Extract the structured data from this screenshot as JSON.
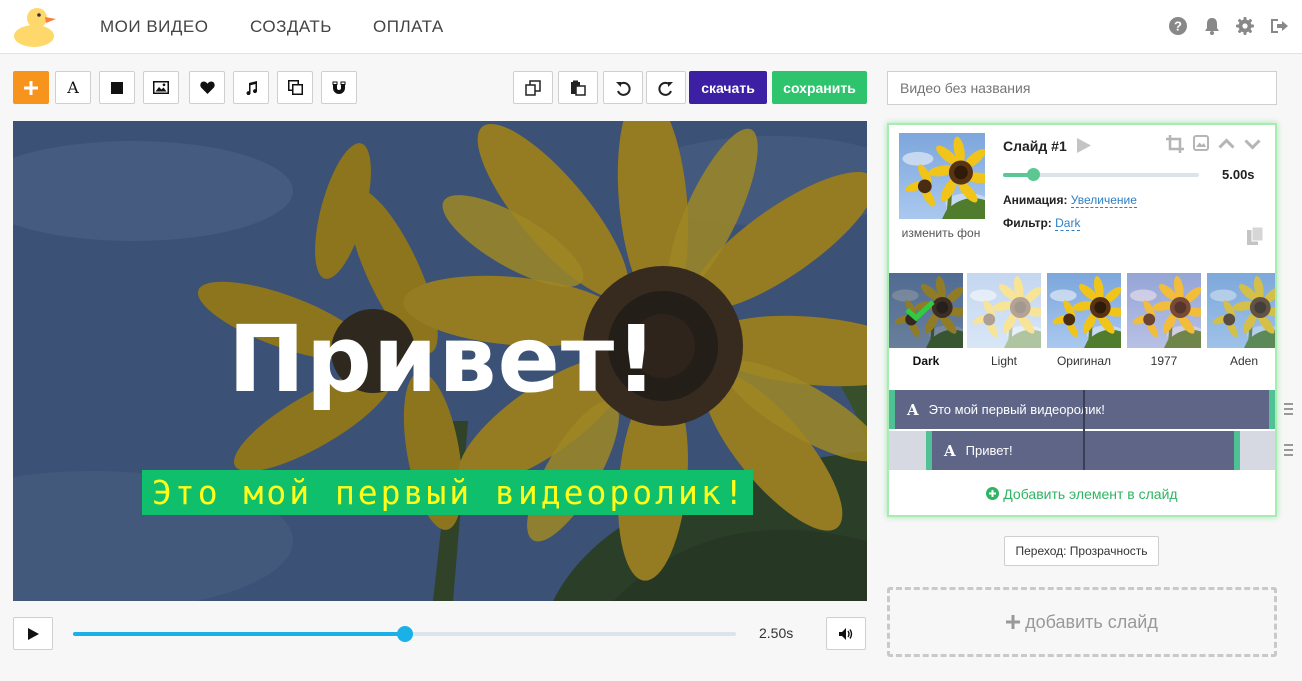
{
  "nav": {
    "items": [
      "МОИ ВИДЕО",
      "СОЗДАТЬ",
      "ОПЛАТА"
    ],
    "icons": [
      "help-icon",
      "bell-icon",
      "gear-icon",
      "logout-icon"
    ]
  },
  "toolbar": {
    "left_tools": [
      "add-icon",
      "text-icon",
      "square-icon",
      "image-icon",
      "heart-icon",
      "music-icon",
      "duplicate-icon",
      "magnet-icon"
    ],
    "right_tools": [
      "copy-icon",
      "paste-icon",
      "undo-icon",
      "redo-icon"
    ],
    "download_label": "скачать",
    "save_label": "сохранить",
    "download_color": "#3d1fa3",
    "save_color": "#2ec46d"
  },
  "canvas": {
    "title": "Привет!",
    "subtitle": "Это мой первый видеоролик!"
  },
  "player": {
    "time": "2.50s",
    "progress": 0.5
  },
  "project": {
    "name_placeholder": "Видео без названия"
  },
  "slide": {
    "title": "Слайд #1",
    "duration": "5.00s",
    "change_bg": "изменить фон",
    "animation_label": "Анимация:",
    "animation_value": "Увеличение",
    "filter_label": "Фильтр:",
    "filter_value": "Dark",
    "filters": [
      {
        "name": "Dark",
        "selected": true
      },
      {
        "name": "Light",
        "selected": false
      },
      {
        "name": "Оригинал",
        "selected": false
      },
      {
        "name": "1977",
        "selected": false
      },
      {
        "name": "Aden",
        "selected": false
      }
    ],
    "layers": [
      {
        "label": "Это мой первый видеоролик!"
      },
      {
        "label": "Привет!"
      }
    ],
    "add_element": "Добавить элемент в слайд"
  },
  "transition": "Переход: Прозрачность",
  "add_slide": "добавить слайд"
}
